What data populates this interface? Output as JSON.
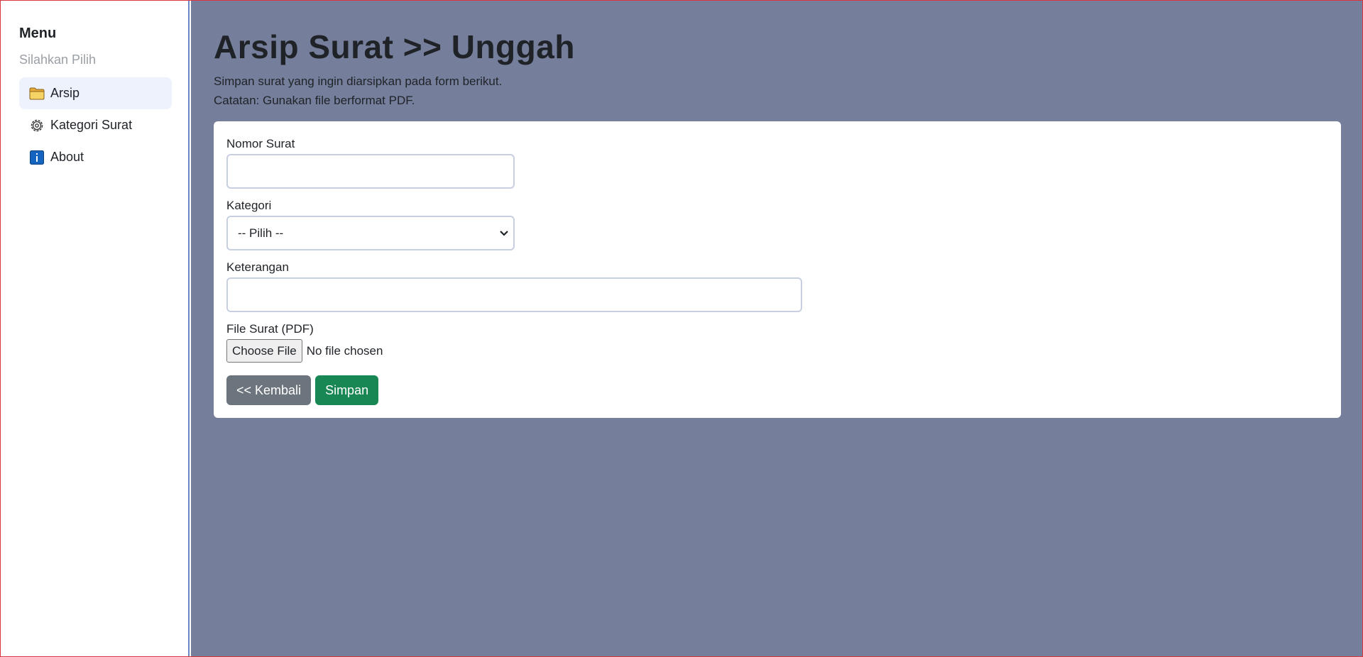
{
  "sidebar": {
    "title": "Menu",
    "subtitle": "Silahkan Pilih",
    "items": [
      {
        "label": "Arsip",
        "icon": "folder-icon",
        "active": true
      },
      {
        "label": "Kategori Surat",
        "icon": "gear-icon",
        "active": false
      },
      {
        "label": "About",
        "icon": "info-icon",
        "active": false
      }
    ]
  },
  "header": {
    "title": "Arsip Surat >> Unggah",
    "desc_line1": "Simpan surat yang ingin diarsipkan pada form berikut.",
    "desc_line2": "Catatan: Gunakan file berformat PDF."
  },
  "form": {
    "nomor_label": "Nomor Surat",
    "nomor_value": "",
    "kategori_label": "Kategori",
    "kategori_selected": "-- Pilih --",
    "keterangan_label": "Keterangan",
    "keterangan_value": "",
    "file_label": "File Surat (PDF)",
    "file_button": "Choose File",
    "file_status": "No file chosen",
    "back_label": "<< Kembali",
    "save_label": "Simpan"
  },
  "colors": {
    "main_bg": "#757e9b",
    "active_item_bg": "#edf2fd",
    "back_button": "#6c757d",
    "save_button": "#198754"
  }
}
